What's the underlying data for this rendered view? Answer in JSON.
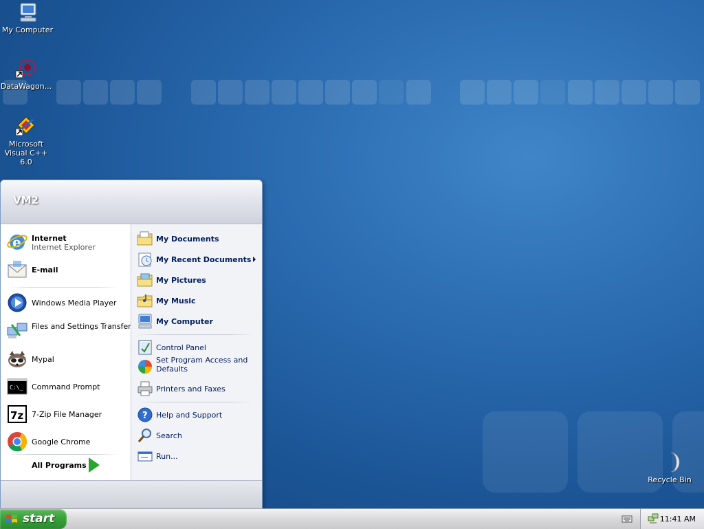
{
  "desktop": {
    "icons": [
      {
        "label": "My Computer",
        "icon": "my-computer-icon"
      },
      {
        "label": "DataWagon...",
        "icon": "datawagon-icon"
      },
      {
        "label": "Microsoft Visual C++ 6.0",
        "icon": "visual-cpp-icon"
      },
      {
        "label": "Recycle Bin",
        "icon": "recycle-bin-icon"
      }
    ]
  },
  "start_menu": {
    "user": "VM2",
    "pinned": [
      {
        "title": "Internet",
        "subtitle": "Internet Explorer",
        "icon": "internet-explorer-icon"
      },
      {
        "title": "E-mail",
        "icon": "email-icon"
      }
    ],
    "recent": [
      {
        "label": "Windows Media Player",
        "icon": "media-player-icon"
      },
      {
        "label": "Files and Settings Transfer Wizard",
        "icon": "transfer-wizard-icon"
      },
      {
        "label": "Mypal",
        "icon": "mypal-icon"
      },
      {
        "label": "Command Prompt",
        "icon": "command-prompt-icon"
      },
      {
        "label": "7-Zip File Manager",
        "icon": "7zip-icon"
      },
      {
        "label": "Google Chrome",
        "icon": "chrome-icon"
      }
    ],
    "all_programs": "All Programs",
    "places": [
      {
        "label": "My Documents",
        "icon": "my-documents-icon"
      },
      {
        "label": "My Recent Documents",
        "icon": "recent-documents-icon",
        "submenu": true
      },
      {
        "label": "My Pictures",
        "icon": "my-pictures-icon"
      },
      {
        "label": "My Music",
        "icon": "my-music-icon"
      },
      {
        "label": "My Computer",
        "icon": "my-computer-icon"
      }
    ],
    "system": [
      {
        "label": "Control Panel",
        "icon": "control-panel-icon"
      },
      {
        "label": "Set Program Access and Defaults",
        "icon": "program-defaults-icon"
      },
      {
        "label": "Printers and Faxes",
        "icon": "printer-icon"
      }
    ],
    "help": [
      {
        "label": "Help and Support",
        "icon": "help-icon"
      },
      {
        "label": "Search",
        "icon": "search-icon"
      },
      {
        "label": "Run...",
        "icon": "run-icon"
      }
    ]
  },
  "taskbar": {
    "start_label": "start",
    "clock": "11:41 AM"
  },
  "colors": {
    "accent_green": "#36a33a",
    "desktop_blue": "#2a6aaf",
    "menu_text_blue": "#001d5e"
  }
}
